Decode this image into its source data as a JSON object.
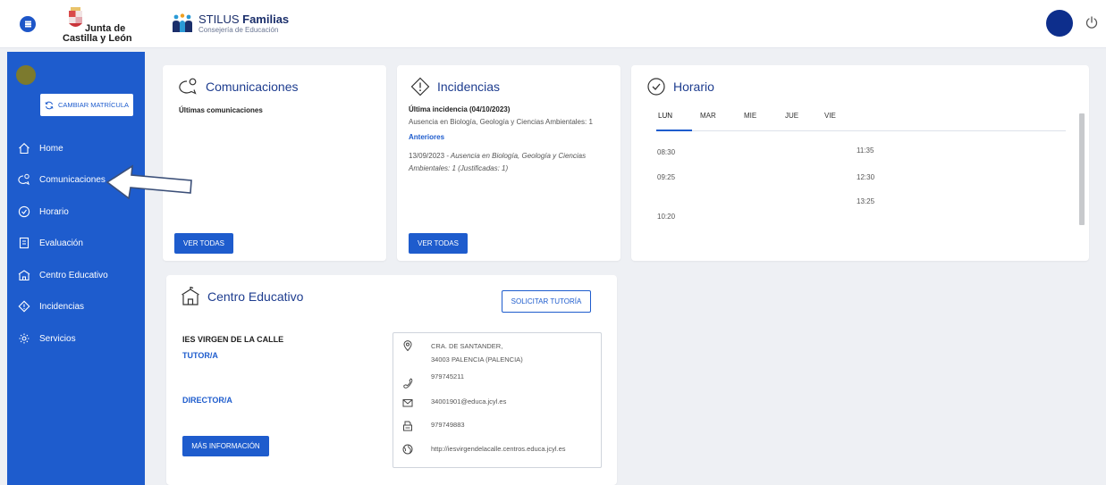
{
  "header": {
    "logo_line1": "Junta de",
    "logo_line2": "Castilla y León",
    "app_name_light": "STILUS ",
    "app_name_bold": "Familias",
    "app_subtitle": "Consejería de Educación"
  },
  "sidebar": {
    "change_button": "CAMBIAR MATRÍCULA",
    "items": [
      {
        "label": "Home",
        "icon": "home-icon"
      },
      {
        "label": "Comunicaciones",
        "icon": "chat-icon"
      },
      {
        "label": "Horario",
        "icon": "clock-icon"
      },
      {
        "label": "Evaluación",
        "icon": "evaluation-icon"
      },
      {
        "label": "Centro Educativo",
        "icon": "school-icon"
      },
      {
        "label": "Incidencias",
        "icon": "warning-icon"
      },
      {
        "label": "Servicios",
        "icon": "settings-icon"
      }
    ]
  },
  "comunicaciones": {
    "title": "Comunicaciones",
    "subtitle": "Últimas comunicaciones",
    "button": "VER TODAS"
  },
  "incidencias": {
    "title": "Incidencias",
    "last_label": "Última incidencia (04/10/2023)",
    "last_text": "Ausencia en Biología, Geología y Ciencias Ambientales: 1",
    "previous_link": "Anteriores",
    "previous_date": "13/09/2023",
    "previous_text_line1": " - Ausencia en Biología, Geología y Ciencias",
    "previous_text_line2": "Ambientales: 1 (Justificadas: 1)",
    "button": "VER TODAS"
  },
  "horario": {
    "title": "Horario",
    "days": [
      "LUN",
      "MAR",
      "MIE",
      "JUE",
      "VIE"
    ],
    "times_left": [
      "08:30",
      "09:25",
      "10:20"
    ],
    "times_right": [
      "11:35",
      "12:30",
      "13:25"
    ]
  },
  "centro": {
    "title": "Centro Educativo",
    "tutoria_button": "SOLICITAR TUTORÍA",
    "school_name": "IES VIRGEN DE LA CALLE",
    "tutor_label": "TUTOR/A",
    "director_label": "DIRECTOR/A",
    "more_button": "MÁS INFORMACIÓN",
    "address_line1": "CRA. DE SANTANDER,",
    "address_line2": "34003 PALENCIA (PALENCIA)",
    "phone": "979745211",
    "email": "34001901@educa.jcyl.es",
    "fax": "979749883",
    "web": "http://iesvirgendelacalle.centros.educa.jcyl.es"
  },
  "colors": {
    "primary": "#1e5ccd",
    "title_blue": "#1e3d8f",
    "background": "#eef0f4"
  }
}
